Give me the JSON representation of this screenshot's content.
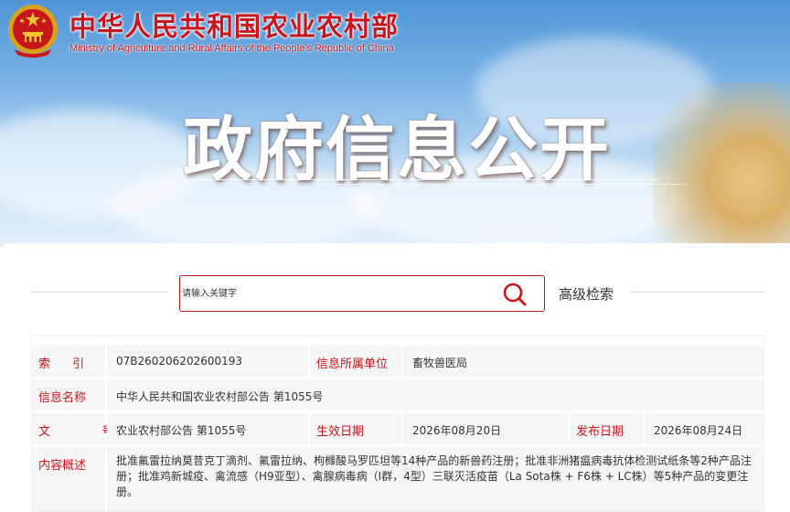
{
  "header": {
    "title": "中华人民共和国农业农村部",
    "subtitle": "Ministry of Agriculture and Rural Affairs of the People's Republic of China",
    "banner_heading": "政府信息公开",
    "brand_color": "#c8161d",
    "emblem_icon": "national-emblem-icon"
  },
  "search": {
    "placeholder": "请输入关键字",
    "button_icon": "search-icon",
    "advanced_label": "高级检索"
  },
  "info": {
    "index_label": "索 引 号",
    "index_value": "07B260206202600193",
    "dept_label": "信息所属单位",
    "dept_value": "畜牧兽医局",
    "name_label": "信息名称",
    "name_value": "中华人民共和国农业农村部公告 第1055号",
    "doc_label": "文 号",
    "doc_value": "农业农村部公告 第1055号",
    "effective_label": "生效日期",
    "effective_value": "2026年08月20日",
    "publish_label": "发布日期",
    "publish_value": "2026年08月24日",
    "summary_label": "内容概述",
    "summary_value": "批准氟雷拉纳莫昔克丁滴剂、氟雷拉纳、枸橼酸马罗匹坦等14种产品的新兽药注册；批准非洲猪瘟病毒抗体检测试纸条等2种产品注册；批准鸡新城疫、禽流感（H9亚型）、禽腺病毒病（I群，4型）三联灭活疫苗（La Sota株 + F6株 + LC株）等5种产品的变更注册。"
  }
}
